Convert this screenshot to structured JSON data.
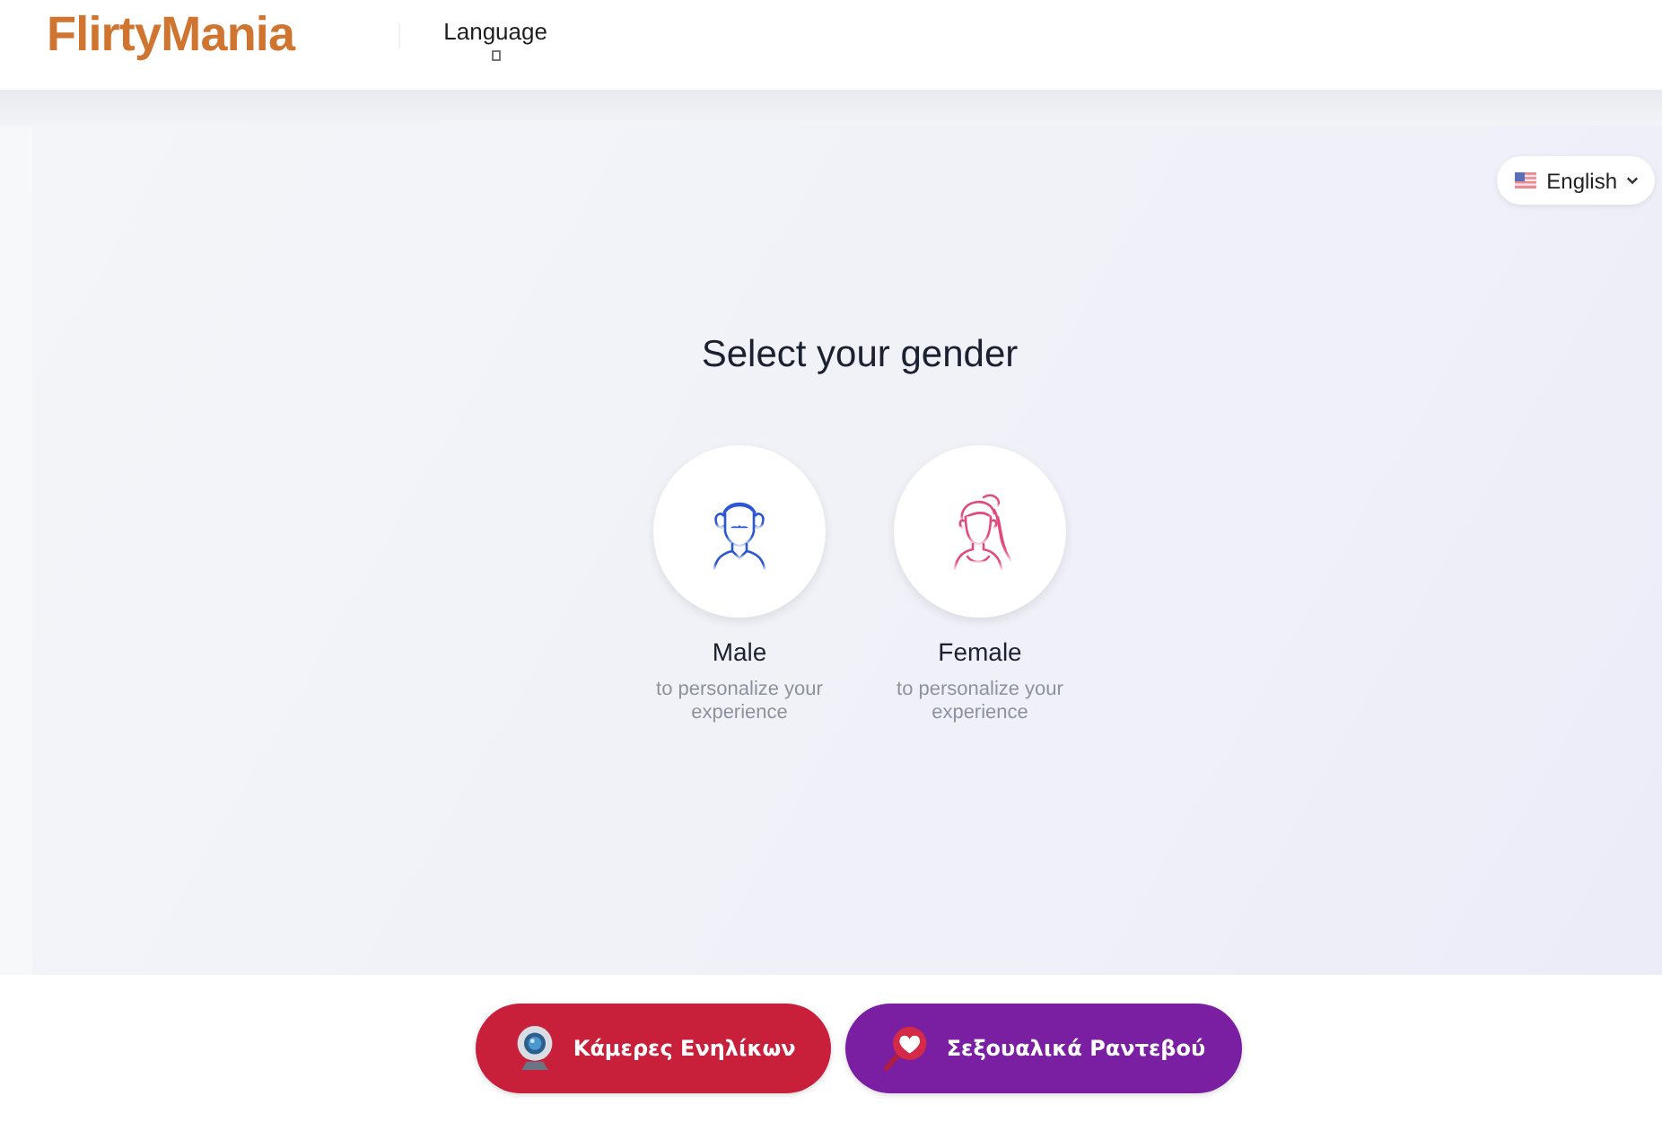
{
  "header": {
    "logo": "FlirtyMania",
    "nav": [
      {
        "label": "Language"
      }
    ]
  },
  "language_selector": {
    "label": "English"
  },
  "gender_select": {
    "title": "Select your gender",
    "options": [
      {
        "kind": "male",
        "label": "Male",
        "description": "to personalize your experience",
        "selected": false
      },
      {
        "kind": "female",
        "label": "Female",
        "description": "to personalize your experience",
        "selected": false
      }
    ]
  },
  "promo_buttons": [
    {
      "kind": "webcam",
      "label": "Κάμερες Ενηλίκων",
      "color": "#c8203a"
    },
    {
      "kind": "dating",
      "label": "Σεξουαλικά Ραντεβού",
      "color": "#7b1fa2"
    }
  ]
}
